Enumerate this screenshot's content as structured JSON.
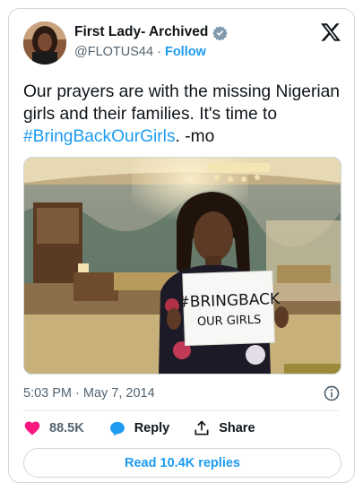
{
  "author": {
    "display_name": "First Lady- Archived",
    "handle": "@FLOTUS44",
    "separator": "·",
    "follow_label": "Follow",
    "verified_icon": "gov-verified-badge-icon"
  },
  "platform_logo": "x-logo-icon",
  "tweet": {
    "text_before": "Our prayers are with the missing Nigerian girls and their families. It's time to ",
    "hashtag": "#BringBackOurGirls",
    "text_after": ". -mo"
  },
  "photo": {
    "sign_line1": "#BRINGBACK",
    "sign_line2": "OUR GIRLS"
  },
  "timestamp": "5:03 PM · May 7, 2014",
  "actions": {
    "like_count": "88.5K",
    "reply_label": "Reply",
    "share_label": "Share"
  },
  "read_replies_label": "Read 10.4K replies",
  "colors": {
    "accent": "#1d9bf0",
    "like": "#f91880",
    "text": "#0f1419",
    "muted": "#536471"
  }
}
